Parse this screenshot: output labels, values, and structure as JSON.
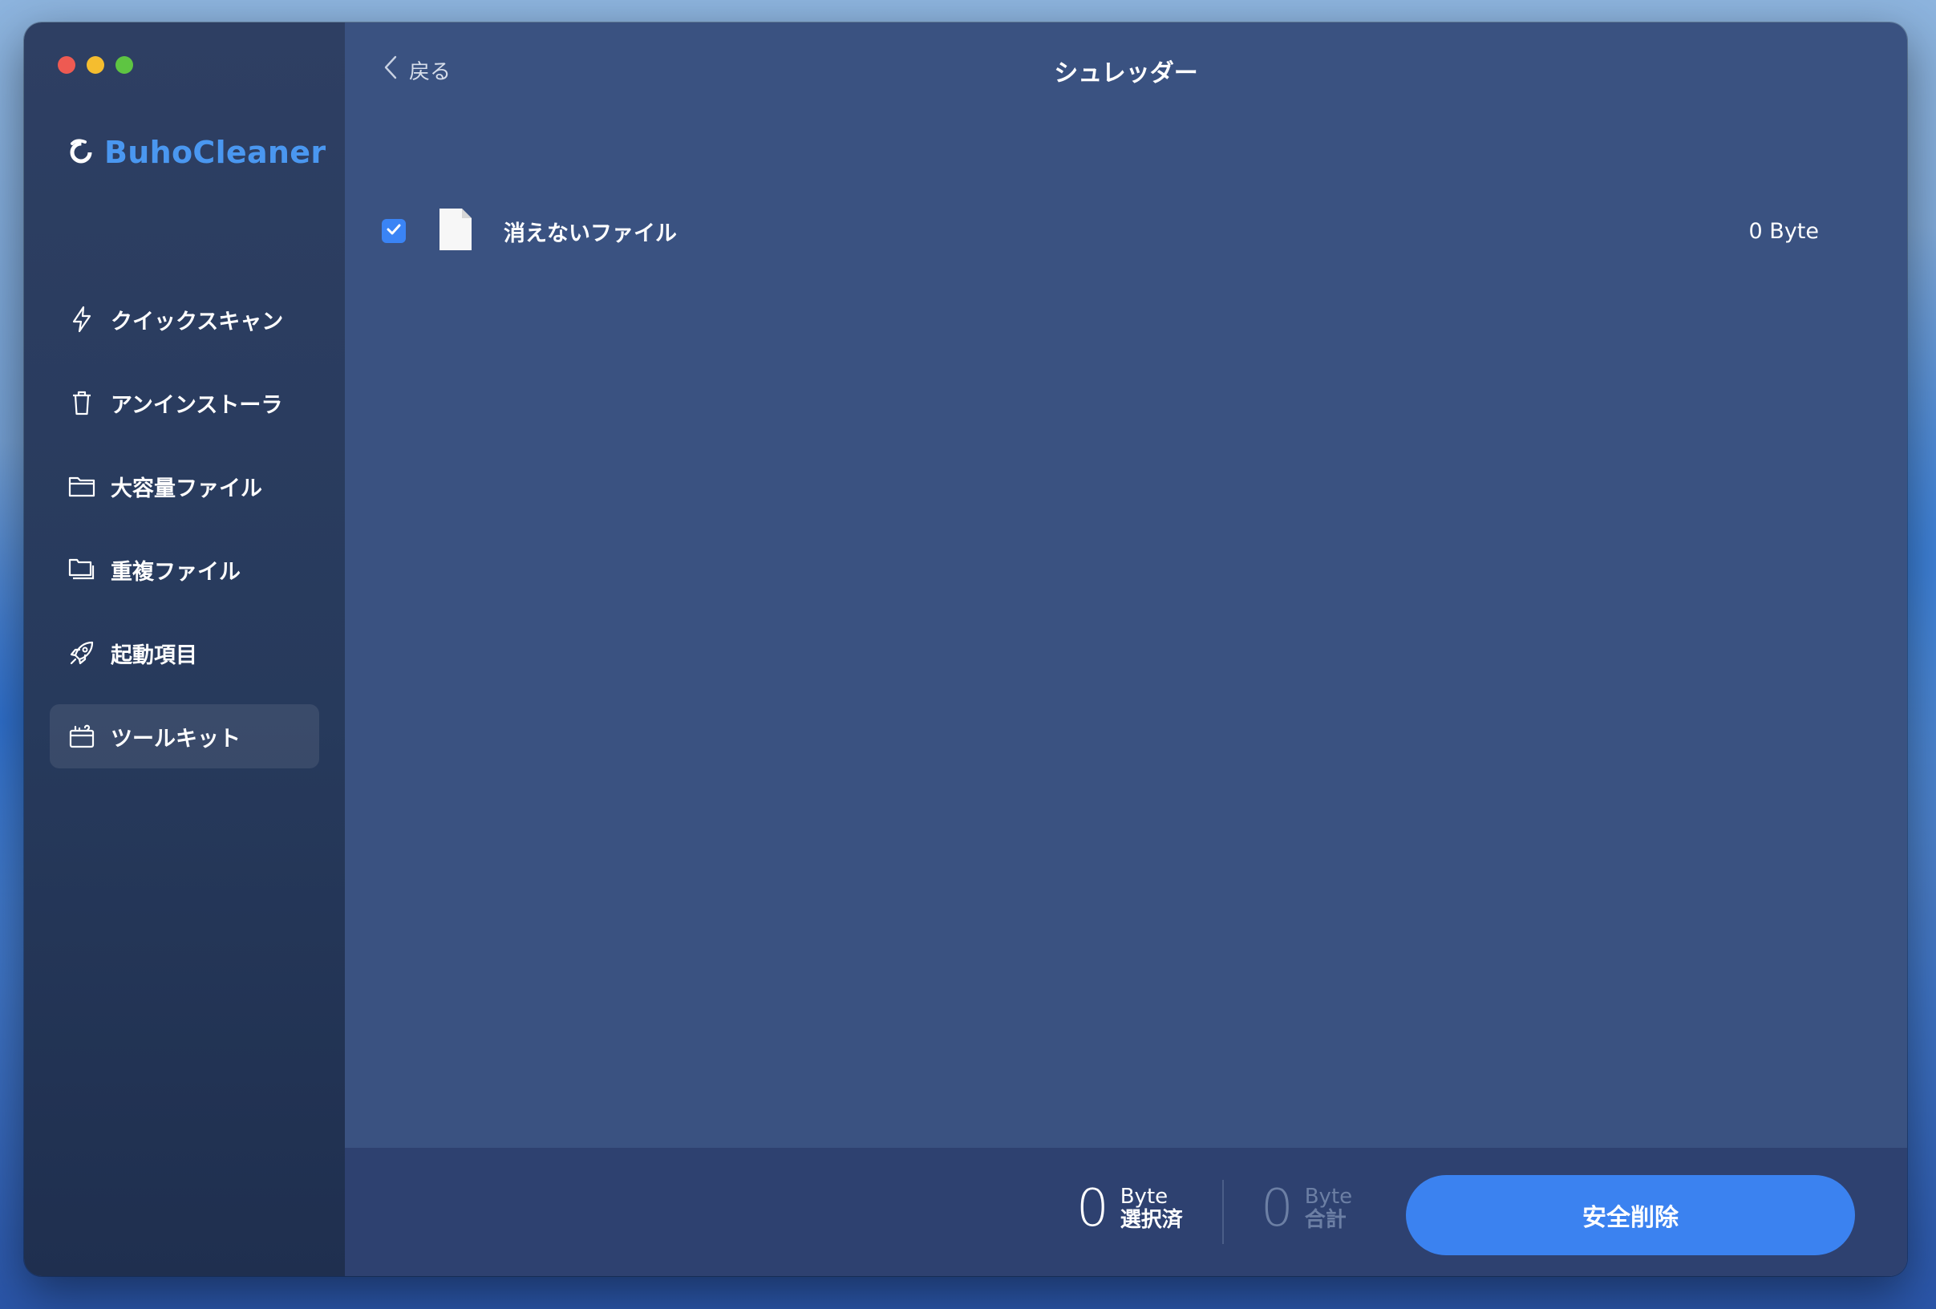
{
  "app": {
    "name": "BuhoCleaner",
    "brand_color": "#4a97f0"
  },
  "sidebar": {
    "items": [
      {
        "label": "クイックスキャン",
        "icon": "lightning-icon",
        "active": false
      },
      {
        "label": "アンインストーラ",
        "icon": "trash-icon",
        "active": false
      },
      {
        "label": "大容量ファイル",
        "icon": "folder-icon",
        "active": false
      },
      {
        "label": "重複ファイル",
        "icon": "duplicate-folder-icon",
        "active": false
      },
      {
        "label": "起動項目",
        "icon": "rocket-icon",
        "active": false
      },
      {
        "label": "ツールキット",
        "icon": "toolkit-icon",
        "active": true
      }
    ]
  },
  "header": {
    "back_label": "戻る",
    "title": "シュレッダー"
  },
  "files": [
    {
      "name": "消えないファイル",
      "size": "0 Byte",
      "checked": true,
      "icon": "document-icon"
    }
  ],
  "footer": {
    "selected": {
      "value": "0",
      "unit": "Byte",
      "label": "選択済"
    },
    "total": {
      "value": "0",
      "unit": "Byte",
      "label": "合計"
    },
    "delete_label": "安全削除"
  },
  "colors": {
    "accent": "#3b82f0",
    "main_bg": "#3a5281",
    "sidebar_bg": "#273a5c",
    "footer_bg": "#2e4170"
  }
}
